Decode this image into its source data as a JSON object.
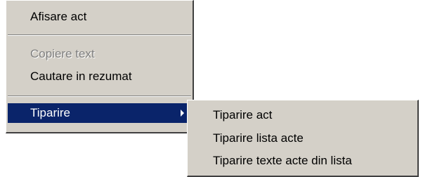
{
  "context_menu": {
    "items": [
      {
        "label": "Afisare act"
      },
      {
        "label": "Copiere text",
        "disabled": true
      },
      {
        "label": "Cautare in rezumat"
      },
      {
        "label": "Tiparire",
        "selected": true,
        "has_submenu": true
      }
    ]
  },
  "submenu": {
    "items": [
      {
        "label": "Tiparire act"
      },
      {
        "label": "Tiparire lista acte"
      },
      {
        "label": "Tiparire texte acte din lista"
      }
    ]
  },
  "colors": {
    "menu_background": "#d4d0c8",
    "highlight_background": "#0a246a",
    "highlight_text": "#ffffff",
    "disabled_text": "#808080"
  }
}
